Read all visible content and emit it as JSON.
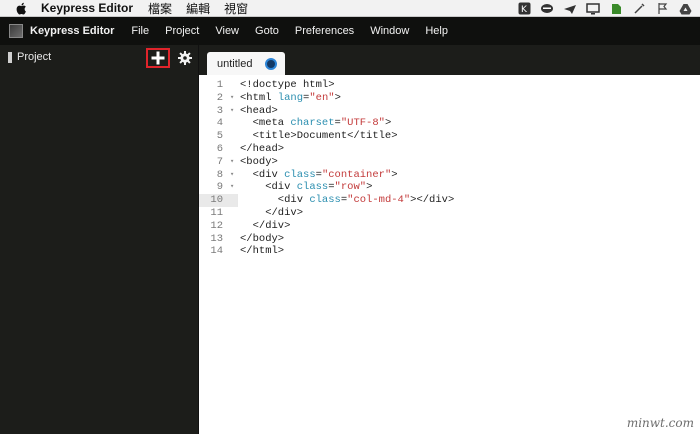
{
  "mac_menubar": {
    "app": "Keypress Editor",
    "items": [
      "檔案",
      "編輯",
      "視窗"
    ]
  },
  "app_toolbar": {
    "name": "Keypress Editor",
    "menu": [
      "File",
      "Project",
      "View",
      "Goto",
      "Preferences",
      "Window",
      "Help"
    ]
  },
  "sidebar": {
    "title": "Project"
  },
  "editor": {
    "tab_label": "untitled",
    "active_line": 10,
    "lines": [
      {
        "num": "1",
        "fold": "",
        "text": "<!doctype html>"
      },
      {
        "num": "2",
        "fold": "▾",
        "text": "<html lang=\"en\">"
      },
      {
        "num": "3",
        "fold": "▾",
        "text": "<head>"
      },
      {
        "num": "4",
        "fold": "",
        "text": "  <meta charset=\"UTF-8\">"
      },
      {
        "num": "5",
        "fold": "",
        "text": "  <title>Document</title>"
      },
      {
        "num": "6",
        "fold": "",
        "text": "</head>"
      },
      {
        "num": "7",
        "fold": "▾",
        "text": "<body>"
      },
      {
        "num": "8",
        "fold": "▾",
        "text": "  <div class=\"container\">"
      },
      {
        "num": "9",
        "fold": "▾",
        "text": "    <div class=\"row\">"
      },
      {
        "num": "10",
        "fold": "",
        "text": "      <div class=\"col-md-4\"></div>"
      },
      {
        "num": "11",
        "fold": "",
        "text": "    </div>"
      },
      {
        "num": "12",
        "fold": "",
        "text": "  </div>"
      },
      {
        "num": "13",
        "fold": "",
        "text": "</body>"
      },
      {
        "num": "14",
        "fold": "",
        "text": "</html>"
      }
    ]
  },
  "watermark": "minwt.com",
  "colors": {
    "highlight_border": "#e0242b",
    "tab_dot": "#2e86d8",
    "attr": "#2c8fb0",
    "string": "#c33a3a"
  }
}
